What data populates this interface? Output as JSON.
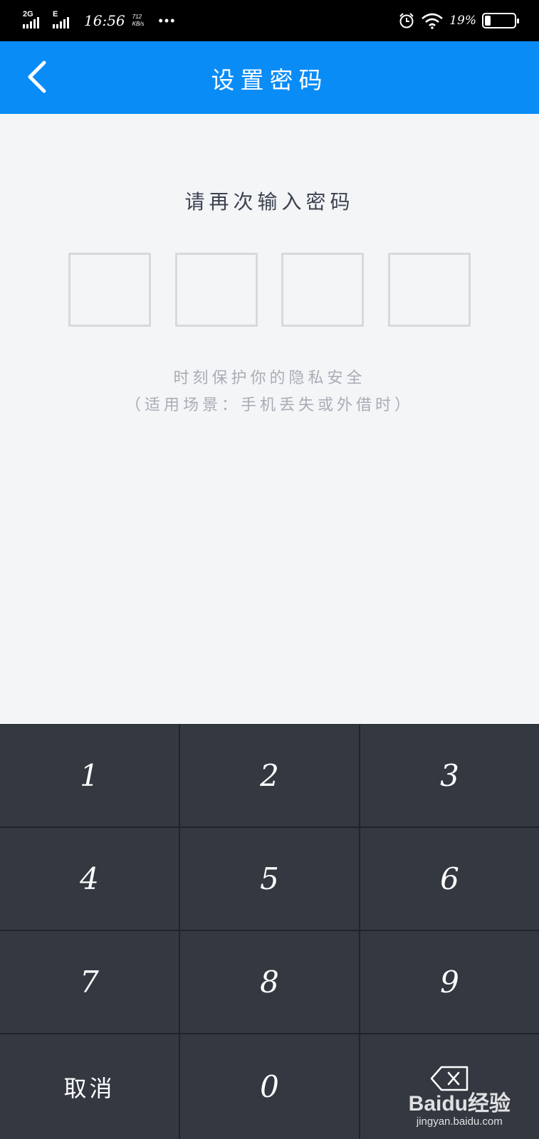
{
  "status_bar": {
    "network_1": "2G",
    "network_2": "E",
    "time": "16:56",
    "speed_value": "712",
    "speed_unit": "KB/s",
    "more": "•••",
    "battery_percent": "19%",
    "battery_level": 0.19,
    "icons": [
      "signal-icon",
      "alarm-icon",
      "wifi-icon",
      "battery-icon"
    ]
  },
  "header": {
    "title": "设置密码",
    "back_icon": "chevron-left-icon",
    "background": "#0a8cf7"
  },
  "main": {
    "prompt": "请再次输入密码",
    "pin_length": 4,
    "hint_line1": "时刻保护你的隐私安全",
    "hint_line2": "（适用场景：手机丢失或外借时）"
  },
  "keypad": {
    "keys": [
      "1",
      "2",
      "3",
      "4",
      "5",
      "6",
      "7",
      "8",
      "9"
    ],
    "cancel_label": "取消",
    "zero_label": "0",
    "delete_icon": "backspace-icon",
    "key_color": "#333841"
  },
  "watermark": {
    "logo": "Baidu经验",
    "url": "jingyan.baidu.com"
  }
}
